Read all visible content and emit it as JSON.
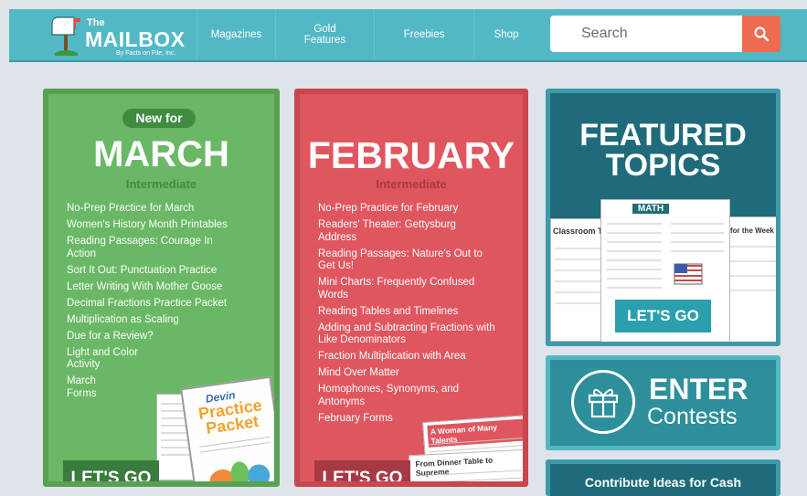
{
  "header": {
    "logo": {
      "the": "The",
      "name": "MAILBOX",
      "tagline": "By Facts on File, Inc."
    },
    "nav": [
      {
        "label": "Magazines"
      },
      {
        "label": "Gold Features"
      },
      {
        "label": "Freebies"
      },
      {
        "label": "Shop"
      }
    ],
    "search": {
      "placeholder": "Search",
      "icon": "search-icon"
    }
  },
  "march": {
    "badge": "New for",
    "title": "MARCH",
    "level": "Intermediate",
    "links": [
      "No-Prep Practice for March",
      "Women's History Month Printables",
      "Reading Passages: Courage In Action",
      "Sort It Out: Punctuation Practice",
      "Letter Writing With Mother Goose",
      "Decimal Fractions Practice Packet",
      "Multiplication as Scaling",
      "Due for a Review?",
      "Light and Color Activity",
      "March Forms"
    ],
    "thumb": {
      "name": "Devin",
      "title": "Practice Packet"
    },
    "cta": "LET'S GO"
  },
  "february": {
    "title": "FEBRUARY",
    "level": "Intermediate",
    "links": [
      "No-Prep Practice for February",
      "Readers' Theater: Gettysburg Address",
      "Reading Passages: Nature's Out to Get Us!",
      "Mini Charts: Frequently Confused Words",
      "Reading Tables and Timelines",
      "Adding and Subtracting Fractions with Like Denominators",
      "Fraction Multiplication with Area",
      "Mind Over Matter",
      "Homophones, Synonyms, and Antonyms",
      "February Forms"
    ],
    "thumb": {
      "top": "A Woman of Many Talents",
      "bottom": "From Dinner Table to Supreme"
    },
    "cta": "LET'S GO"
  },
  "featured": {
    "title_line1": "FEATURED",
    "title_line2": "TOPICS",
    "thumb_left": "Classroom Tim",
    "thumb_center": "MATH",
    "thumb_right": "for the Week",
    "cta": "LET'S GO"
  },
  "contests": {
    "line1": "ENTER",
    "line2": "Contests",
    "icon": "gift-icon"
  },
  "contribute": {
    "label": "Contribute Ideas for Cash"
  },
  "colors": {
    "header": "#53b8c6",
    "search_button": "#ef6b4f",
    "march": "#6ab865",
    "february": "#e0565f",
    "featured": "#1f6b7a",
    "contests": "#2c8f9b"
  }
}
